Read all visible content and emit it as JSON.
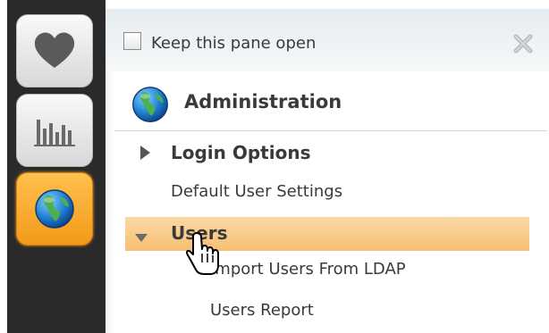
{
  "rail": {
    "items": [
      {
        "icon": "heart-icon",
        "active": false
      },
      {
        "icon": "bar-chart-icon",
        "active": false
      },
      {
        "icon": "globe-icon",
        "active": true
      }
    ]
  },
  "pane": {
    "keep_open_label": "Keep this pane open",
    "keep_open_checked": false,
    "close_icon": "close-icon",
    "section_icon": "globe-icon",
    "section_title": "Administration",
    "items": [
      {
        "label": "Login Options",
        "expanded": false
      },
      {
        "label": "Default User Settings"
      },
      {
        "label": "Users",
        "expanded": true,
        "highlighted": true
      }
    ],
    "sub_items": [
      {
        "label": "Import Users From LDAP"
      },
      {
        "label": "Users Report"
      }
    ]
  },
  "colors": {
    "rail_background": "#2a2a2a",
    "active_accent": "#f39a18",
    "highlight_row": "#f8c47e",
    "text": "#3a3a3a"
  }
}
